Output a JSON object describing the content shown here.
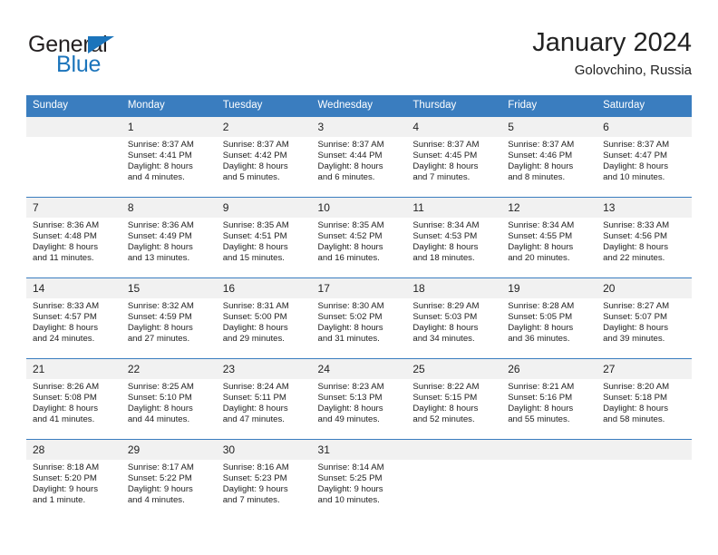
{
  "brand": {
    "name_part1": "General",
    "name_part2": "Blue",
    "triangle_icon": "triangle-icon",
    "colors": {
      "dark": "#231f20",
      "blue": "#1b74bb"
    }
  },
  "header": {
    "title": "January 2024",
    "subtitle": "Golovchino, Russia"
  },
  "calendar": {
    "header_color": "#3a7dbf",
    "daynum_bg": "#f1f1f1",
    "weekday_headers": [
      "Sunday",
      "Monday",
      "Tuesday",
      "Wednesday",
      "Thursday",
      "Friday",
      "Saturday"
    ],
    "weeks": [
      [
        {
          "day": "",
          "sunrise": "",
          "sunset": "",
          "daylight_line1": "",
          "daylight_line2": ""
        },
        {
          "day": "1",
          "sunrise": "Sunrise: 8:37 AM",
          "sunset": "Sunset: 4:41 PM",
          "daylight_line1": "Daylight: 8 hours",
          "daylight_line2": "and 4 minutes."
        },
        {
          "day": "2",
          "sunrise": "Sunrise: 8:37 AM",
          "sunset": "Sunset: 4:42 PM",
          "daylight_line1": "Daylight: 8 hours",
          "daylight_line2": "and 5 minutes."
        },
        {
          "day": "3",
          "sunrise": "Sunrise: 8:37 AM",
          "sunset": "Sunset: 4:44 PM",
          "daylight_line1": "Daylight: 8 hours",
          "daylight_line2": "and 6 minutes."
        },
        {
          "day": "4",
          "sunrise": "Sunrise: 8:37 AM",
          "sunset": "Sunset: 4:45 PM",
          "daylight_line1": "Daylight: 8 hours",
          "daylight_line2": "and 7 minutes."
        },
        {
          "day": "5",
          "sunrise": "Sunrise: 8:37 AM",
          "sunset": "Sunset: 4:46 PM",
          "daylight_line1": "Daylight: 8 hours",
          "daylight_line2": "and 8 minutes."
        },
        {
          "day": "6",
          "sunrise": "Sunrise: 8:37 AM",
          "sunset": "Sunset: 4:47 PM",
          "daylight_line1": "Daylight: 8 hours",
          "daylight_line2": "and 10 minutes."
        }
      ],
      [
        {
          "day": "7",
          "sunrise": "Sunrise: 8:36 AM",
          "sunset": "Sunset: 4:48 PM",
          "daylight_line1": "Daylight: 8 hours",
          "daylight_line2": "and 11 minutes."
        },
        {
          "day": "8",
          "sunrise": "Sunrise: 8:36 AM",
          "sunset": "Sunset: 4:49 PM",
          "daylight_line1": "Daylight: 8 hours",
          "daylight_line2": "and 13 minutes."
        },
        {
          "day": "9",
          "sunrise": "Sunrise: 8:35 AM",
          "sunset": "Sunset: 4:51 PM",
          "daylight_line1": "Daylight: 8 hours",
          "daylight_line2": "and 15 minutes."
        },
        {
          "day": "10",
          "sunrise": "Sunrise: 8:35 AM",
          "sunset": "Sunset: 4:52 PM",
          "daylight_line1": "Daylight: 8 hours",
          "daylight_line2": "and 16 minutes."
        },
        {
          "day": "11",
          "sunrise": "Sunrise: 8:34 AM",
          "sunset": "Sunset: 4:53 PM",
          "daylight_line1": "Daylight: 8 hours",
          "daylight_line2": "and 18 minutes."
        },
        {
          "day": "12",
          "sunrise": "Sunrise: 8:34 AM",
          "sunset": "Sunset: 4:55 PM",
          "daylight_line1": "Daylight: 8 hours",
          "daylight_line2": "and 20 minutes."
        },
        {
          "day": "13",
          "sunrise": "Sunrise: 8:33 AM",
          "sunset": "Sunset: 4:56 PM",
          "daylight_line1": "Daylight: 8 hours",
          "daylight_line2": "and 22 minutes."
        }
      ],
      [
        {
          "day": "14",
          "sunrise": "Sunrise: 8:33 AM",
          "sunset": "Sunset: 4:57 PM",
          "daylight_line1": "Daylight: 8 hours",
          "daylight_line2": "and 24 minutes."
        },
        {
          "day": "15",
          "sunrise": "Sunrise: 8:32 AM",
          "sunset": "Sunset: 4:59 PM",
          "daylight_line1": "Daylight: 8 hours",
          "daylight_line2": "and 27 minutes."
        },
        {
          "day": "16",
          "sunrise": "Sunrise: 8:31 AM",
          "sunset": "Sunset: 5:00 PM",
          "daylight_line1": "Daylight: 8 hours",
          "daylight_line2": "and 29 minutes."
        },
        {
          "day": "17",
          "sunrise": "Sunrise: 8:30 AM",
          "sunset": "Sunset: 5:02 PM",
          "daylight_line1": "Daylight: 8 hours",
          "daylight_line2": "and 31 minutes."
        },
        {
          "day": "18",
          "sunrise": "Sunrise: 8:29 AM",
          "sunset": "Sunset: 5:03 PM",
          "daylight_line1": "Daylight: 8 hours",
          "daylight_line2": "and 34 minutes."
        },
        {
          "day": "19",
          "sunrise": "Sunrise: 8:28 AM",
          "sunset": "Sunset: 5:05 PM",
          "daylight_line1": "Daylight: 8 hours",
          "daylight_line2": "and 36 minutes."
        },
        {
          "day": "20",
          "sunrise": "Sunrise: 8:27 AM",
          "sunset": "Sunset: 5:07 PM",
          "daylight_line1": "Daylight: 8 hours",
          "daylight_line2": "and 39 minutes."
        }
      ],
      [
        {
          "day": "21",
          "sunrise": "Sunrise: 8:26 AM",
          "sunset": "Sunset: 5:08 PM",
          "daylight_line1": "Daylight: 8 hours",
          "daylight_line2": "and 41 minutes."
        },
        {
          "day": "22",
          "sunrise": "Sunrise: 8:25 AM",
          "sunset": "Sunset: 5:10 PM",
          "daylight_line1": "Daylight: 8 hours",
          "daylight_line2": "and 44 minutes."
        },
        {
          "day": "23",
          "sunrise": "Sunrise: 8:24 AM",
          "sunset": "Sunset: 5:11 PM",
          "daylight_line1": "Daylight: 8 hours",
          "daylight_line2": "and 47 minutes."
        },
        {
          "day": "24",
          "sunrise": "Sunrise: 8:23 AM",
          "sunset": "Sunset: 5:13 PM",
          "daylight_line1": "Daylight: 8 hours",
          "daylight_line2": "and 49 minutes."
        },
        {
          "day": "25",
          "sunrise": "Sunrise: 8:22 AM",
          "sunset": "Sunset: 5:15 PM",
          "daylight_line1": "Daylight: 8 hours",
          "daylight_line2": "and 52 minutes."
        },
        {
          "day": "26",
          "sunrise": "Sunrise: 8:21 AM",
          "sunset": "Sunset: 5:16 PM",
          "daylight_line1": "Daylight: 8 hours",
          "daylight_line2": "and 55 minutes."
        },
        {
          "day": "27",
          "sunrise": "Sunrise: 8:20 AM",
          "sunset": "Sunset: 5:18 PM",
          "daylight_line1": "Daylight: 8 hours",
          "daylight_line2": "and 58 minutes."
        }
      ],
      [
        {
          "day": "28",
          "sunrise": "Sunrise: 8:18 AM",
          "sunset": "Sunset: 5:20 PM",
          "daylight_line1": "Daylight: 9 hours",
          "daylight_line2": "and 1 minute."
        },
        {
          "day": "29",
          "sunrise": "Sunrise: 8:17 AM",
          "sunset": "Sunset: 5:22 PM",
          "daylight_line1": "Daylight: 9 hours",
          "daylight_line2": "and 4 minutes."
        },
        {
          "day": "30",
          "sunrise": "Sunrise: 8:16 AM",
          "sunset": "Sunset: 5:23 PM",
          "daylight_line1": "Daylight: 9 hours",
          "daylight_line2": "and 7 minutes."
        },
        {
          "day": "31",
          "sunrise": "Sunrise: 8:14 AM",
          "sunset": "Sunset: 5:25 PM",
          "daylight_line1": "Daylight: 9 hours",
          "daylight_line2": "and 10 minutes."
        },
        {
          "day": "",
          "sunrise": "",
          "sunset": "",
          "daylight_line1": "",
          "daylight_line2": ""
        },
        {
          "day": "",
          "sunrise": "",
          "sunset": "",
          "daylight_line1": "",
          "daylight_line2": ""
        },
        {
          "day": "",
          "sunrise": "",
          "sunset": "",
          "daylight_line1": "",
          "daylight_line2": ""
        }
      ]
    ]
  }
}
